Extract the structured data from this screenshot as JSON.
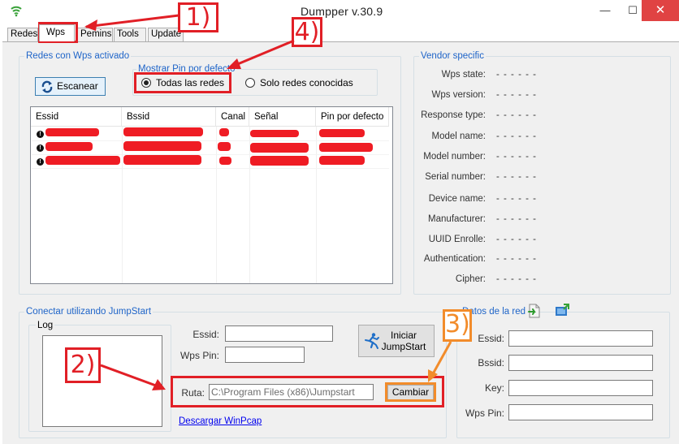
{
  "window": {
    "title": "Dumpper v.30.9",
    "minimize": "—",
    "maximize": "☐",
    "close": "✕"
  },
  "tabs": [
    {
      "label": "Redes"
    },
    {
      "label": "Wps"
    },
    {
      "label": "Pemins"
    },
    {
      "label": "Tools"
    },
    {
      "label": "Update"
    }
  ],
  "redes_group": {
    "title": "Redes con Wps activado",
    "scan_button": "Escanear",
    "mostrar_title": "Mostrar Pin por defecto",
    "radio_all": "Todas las redes",
    "radio_known": "Solo redes conocidas",
    "columns": [
      "Essid",
      "Bssid",
      "Canal",
      "Señal",
      "Pin por defecto"
    ],
    "rows": 3
  },
  "vendor": {
    "title": "Vendor specific",
    "fields": [
      {
        "label": "Wps state:",
        "value": "- - - - - -"
      },
      {
        "label": "Wps version:",
        "value": "- - - - - -"
      },
      {
        "label": "Response type:",
        "value": "- - - - - -"
      },
      {
        "label": "Model name:",
        "value": "- - - - - -"
      },
      {
        "label": "Model number:",
        "value": "- - - - - -"
      },
      {
        "label": "Serial number:",
        "value": "- - - - - -"
      },
      {
        "label": "Device name:",
        "value": "- - - - - -"
      },
      {
        "label": "Manufacturer:",
        "value": "- - - - - -"
      },
      {
        "label": "UUID Enrolle:",
        "value": "- - - - - -"
      },
      {
        "label": "Authentication:",
        "value": "- - - - - -"
      },
      {
        "label": "Cipher:",
        "value": "- - - - - -"
      }
    ]
  },
  "jumpstart": {
    "title": "Conectar utilizando JumpStart",
    "log_title": "Log",
    "essid_label": "Essid:",
    "wpspin_label": "Wps Pin:",
    "iniciar_line1": "Iniciar",
    "iniciar_line2": "JumpStart",
    "ruta_label": "Ruta:",
    "ruta_value": "C:\\Program Files (x86)\\Jumpstart",
    "cambiar_button": "Cambiar",
    "winpcap_link": "Descargar WinPcap"
  },
  "datos": {
    "title": "Datos de la red",
    "fields": [
      {
        "label": "Essid:"
      },
      {
        "label": "Bssid:"
      },
      {
        "label": "Key:"
      },
      {
        "label": "Wps Pin:"
      }
    ]
  },
  "annotations": {
    "n1": "1)",
    "n2": "2)",
    "n3": "3)",
    "n4": "4)",
    "red": "#e11f26",
    "orange": "#f28c2b"
  }
}
